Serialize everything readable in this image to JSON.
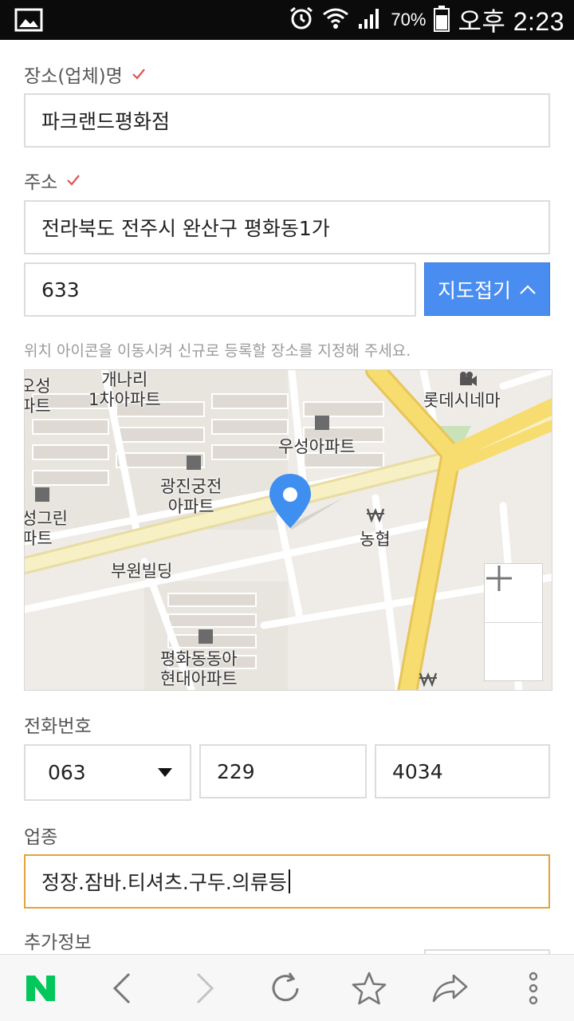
{
  "status_bar": {
    "battery_percent": "70%",
    "time": "오후 2:23",
    "icons": [
      "gallery-icon",
      "alarm-icon",
      "wifi-icon",
      "signal-icon",
      "battery-icon"
    ]
  },
  "form": {
    "place_name": {
      "label": "장소(업체)명",
      "value": "파크랜드평화점"
    },
    "address": {
      "label": "주소",
      "value": "전라북도 전주시 완산구 평화동1가",
      "detail": "633",
      "map_toggle": "지도접기"
    },
    "hint": "위치 아이콘을 이동시켜 신규로 등록할 장소를 지정해 주세요.",
    "phone": {
      "label": "전화번호",
      "area_code": "063",
      "middle": "229",
      "last": "4034"
    },
    "business_type": {
      "label": "업종",
      "value": "정장.잠바.티셔츠.구두.의류등"
    },
    "extra": {
      "label": "추가정보"
    }
  },
  "map": {
    "labels": {
      "l1": "개나리\n1차아파트",
      "l2": "오성\n파트",
      "l3": "롯데시네마",
      "l4": "우성아파트",
      "l5": "광진궁전\n아파트",
      "l6": "성그린\n파트",
      "l7": "농협",
      "l8": "부원빌딩",
      "l9": "평화동동아\n현대아파트"
    },
    "colors": {
      "major_road": "#f7dc6f",
      "pin": "#3f8ff0",
      "land": "#efece7"
    }
  },
  "toolbar": {
    "items": [
      "naver-logo-icon",
      "back-icon",
      "forward-icon",
      "refresh-icon",
      "bookmark-star-icon",
      "share-icon",
      "more-icon"
    ],
    "logo_color": "#03c75a"
  }
}
